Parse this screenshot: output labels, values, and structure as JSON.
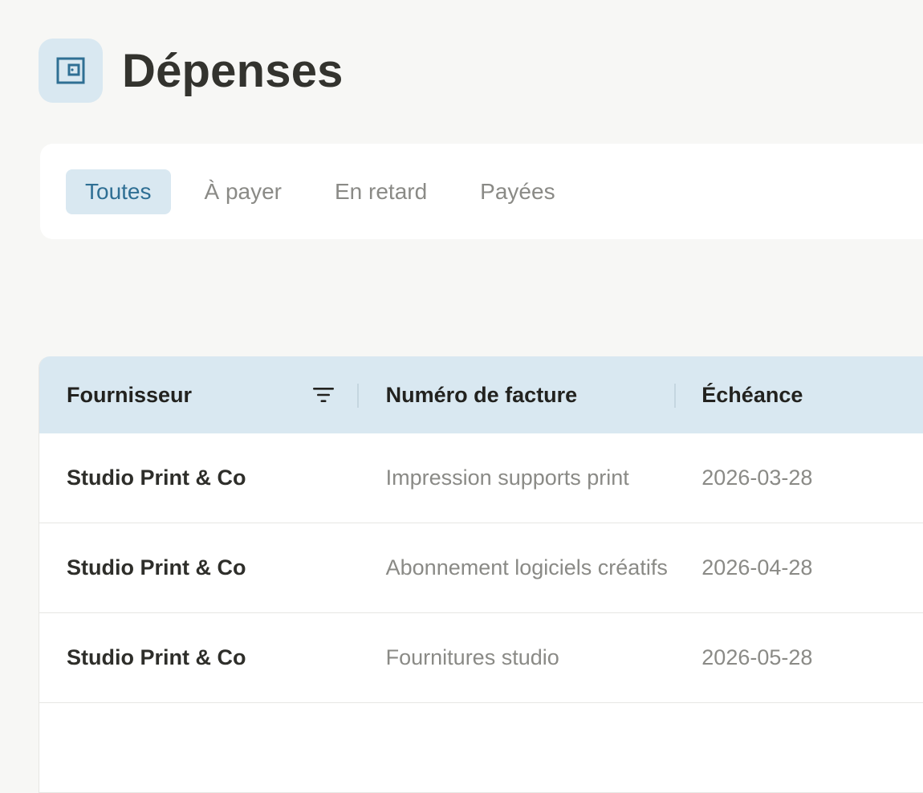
{
  "page": {
    "title": "Dépenses",
    "icon": "wallet-icon",
    "accent_color": "#2f6f94",
    "accent_bg": "#d9e8f1"
  },
  "tabs": [
    {
      "label": "Toutes",
      "active": true
    },
    {
      "label": "À payer",
      "active": false
    },
    {
      "label": "En retard",
      "active": false
    },
    {
      "label": "Payées",
      "active": false
    }
  ],
  "table": {
    "columns": [
      "Fournisseur",
      "Numéro de facture",
      "Échéance"
    ],
    "filter_icon": "filter-icon",
    "rows": [
      {
        "vendor": "Studio Print & Co",
        "invoice": "Impression supports print",
        "due": "2026-03-28"
      },
      {
        "vendor": "Studio Print & Co",
        "invoice": "Abonnement logiciels créatifs",
        "due": "2026-04-28"
      },
      {
        "vendor": "Studio Print & Co",
        "invoice": "Fournitures studio",
        "due": "2026-05-28"
      }
    ]
  }
}
